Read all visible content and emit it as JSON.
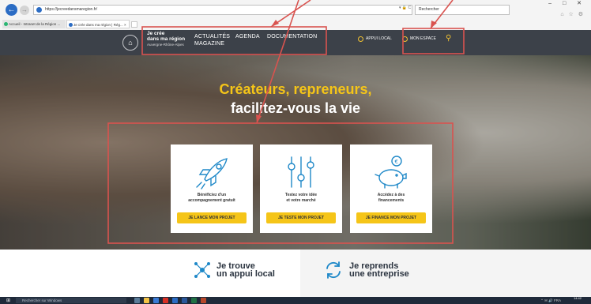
{
  "browser": {
    "url": "https://jecreedansmaregion.fr/",
    "search_placeholder": "Rechercher",
    "addr_tools": "▾ 🔒 C",
    "tabs": [
      {
        "label": "Accueil - Intranet de la Région ..."
      },
      {
        "label": "Je crée dans ma région | Rég... ×"
      }
    ],
    "window_controls": "–  □  ✕",
    "right_tools": "⌂ ☆ ⚙"
  },
  "site": {
    "logo": {
      "line1": "Je crée",
      "line2": "dans ma région",
      "subtitle": "Auvergne-Rhône-Alpes"
    },
    "nav": {
      "actualites": "ACTUALITÉS",
      "magazine": "MAGAZINE",
      "agenda": "AGENDA",
      "documentation": "DOCUMENTATION"
    },
    "header_buttons": {
      "appui_local": "APPUI LOCAL",
      "mon_espace": "MON ESPACE"
    },
    "hero": {
      "title_line1": "Créateurs, repreneurs,",
      "title_line2": "facilitez-vous la vie"
    },
    "cards": [
      {
        "icon": "rocket-icon",
        "desc": "Bénéficiez d'un\naccompagnement gratuit",
        "cta": "JE LANCE MON PROJET"
      },
      {
        "icon": "sliders-icon",
        "desc": "Testez votre idée\net votre marché",
        "cta": "JE TESTE MON PROJET"
      },
      {
        "icon": "piggy-bank-icon",
        "desc": "Accédez à des\nfinancements",
        "cta": "JE FINANCE MON PROJET"
      }
    ],
    "quick_links": [
      {
        "label": "Je trouve\nun appui local",
        "icon": "network-icon"
      },
      {
        "label": "Je reprends\nune entreprise",
        "icon": "refresh-icon"
      }
    ]
  },
  "taskbar": {
    "search_placeholder": "Rechercher sur Windows",
    "time": "14:42",
    "date": "",
    "tray": "⌃ ✉ 🔊 FRA"
  },
  "colors": {
    "header_bg": "#3c4149",
    "accent_yellow": "#f5c518",
    "annotation_red": "#d9534f"
  }
}
